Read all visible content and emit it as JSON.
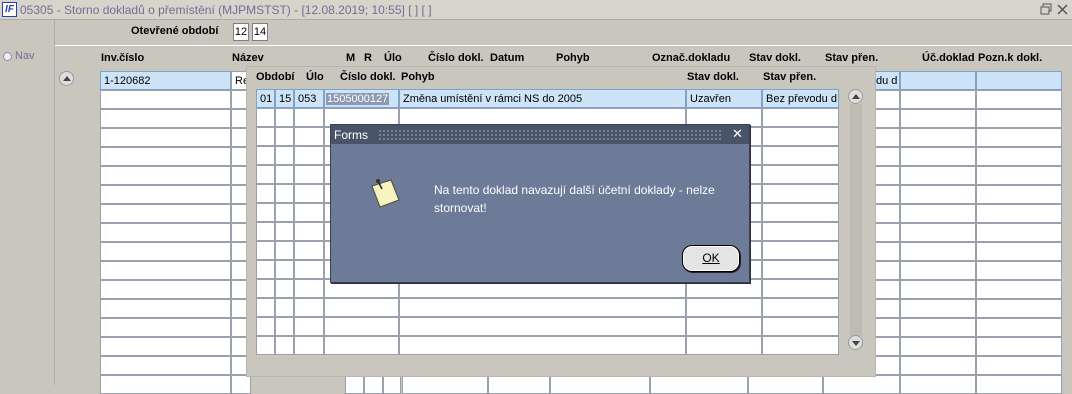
{
  "window": {
    "title": "05305 - Storno dokladů o přemístění (MJPMSTST) - [12.08.2019; 10:55]  [ ]  [ ]",
    "app_icon": "IF"
  },
  "nav": {
    "label": "Nav"
  },
  "period": {
    "label": "Otevřené období",
    "values": [
      "12",
      "14"
    ]
  },
  "main_columns": [
    "Inv.číslo",
    "Název",
    "M",
    "R",
    "Úlo",
    "Číslo dokl.",
    "Datum",
    "Pohyb",
    "Označ.dokladu",
    "Stav dokl.",
    "Stav přen.",
    "Úč.doklad",
    "Pozn.k dokl."
  ],
  "main_rows": {
    "first": {
      "inv_cislo": "1-120682",
      "nazev": "Re",
      "stav_pren": "du d"
    }
  },
  "detail_columns": [
    "Období",
    "Úlo",
    "Číslo dokl.",
    "Pohyb",
    "Stav dokl.",
    "Stav přen."
  ],
  "detail_row": {
    "obdobi_a": "01",
    "obdobi_b": "15",
    "ulo": "053",
    "cislo_dokl": "1505000127",
    "pohyb": "Změna umístění v rámci NS do 2005",
    "stav_dokl": "Uzavřen",
    "stav_pren": "Bez převodu d"
  },
  "dialog": {
    "title": "Forms",
    "message": "Na tento doklad navazují další účetní doklady - nelze stornovat!",
    "ok_label": "OK",
    "icon": "note-icon"
  },
  "colors": {
    "background": "#c9c6bd",
    "highlight": "#cde3f7",
    "dialog": "#6d7a98",
    "title_text": "#6f6f96"
  }
}
